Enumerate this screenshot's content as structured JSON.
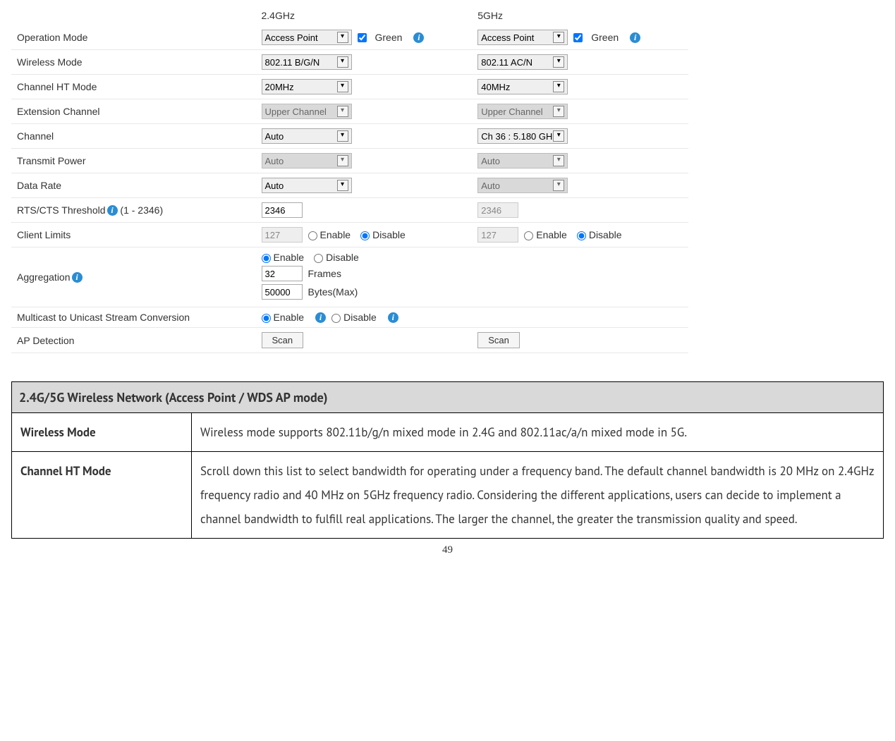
{
  "headers": {
    "band24": "2.4GHz",
    "band5": "5GHz"
  },
  "rows": {
    "operation_mode": {
      "label": "Operation Mode",
      "val24": "Access Point",
      "green": "Green",
      "val5": "Access Point"
    },
    "wireless_mode": {
      "label": "Wireless Mode",
      "val24": "802.11 B/G/N",
      "val5": "802.11 AC/N"
    },
    "channel_ht": {
      "label": "Channel HT Mode",
      "val24": "20MHz",
      "val5": "40MHz"
    },
    "ext_channel": {
      "label": "Extension Channel",
      "val24": "Upper Channel",
      "val5": "Upper Channel"
    },
    "channel": {
      "label": "Channel",
      "val24": "Auto",
      "val5": "Ch 36 : 5.180 GH"
    },
    "tx_power": {
      "label": "Transmit Power",
      "val24": "Auto",
      "val5": "Auto"
    },
    "data_rate": {
      "label": "Data Rate",
      "val24": "Auto",
      "val5": "Auto"
    },
    "rts": {
      "label_pre": "RTS/CTS Threshold",
      "label_post": " (1 - 2346)",
      "val24": "2346",
      "val5": "2346"
    },
    "client_limits": {
      "label": "Client Limits",
      "val24": "127",
      "val5": "127",
      "enable": "Enable",
      "disable": "Disable"
    },
    "aggregation": {
      "label": "Aggregation",
      "enable": "Enable",
      "disable": "Disable",
      "frames_val": "32",
      "frames_lbl": "Frames",
      "bytes_val": "50000",
      "bytes_lbl": "Bytes(Max)"
    },
    "multicast": {
      "label": "Multicast to Unicast Stream Conversion",
      "enable": "Enable",
      "disable": "Disable"
    },
    "ap_detection": {
      "label": "AP Detection",
      "scan": "Scan"
    }
  },
  "doc": {
    "title": "2.4G/5G Wireless Network (Access Point / WDS AP mode)",
    "items": [
      {
        "name": "Wireless Mode",
        "desc": "Wireless mode supports 802.11b/g/n mixed mode in 2.4G and 802.11ac/a/n mixed mode in 5G."
      },
      {
        "name": "Channel HT Mode",
        "desc": "Scroll down this list to select bandwidth for operating under a frequency band. The default channel bandwidth is 20 MHz on 2.4GHz frequency radio and 40 MHz on 5GHz frequency radio. Considering the different applications, users can decide to implement a channel bandwidth to fulfill real applications. The larger the channel, the greater the transmission quality and speed."
      }
    ]
  },
  "page": "49",
  "icon_i": "i"
}
